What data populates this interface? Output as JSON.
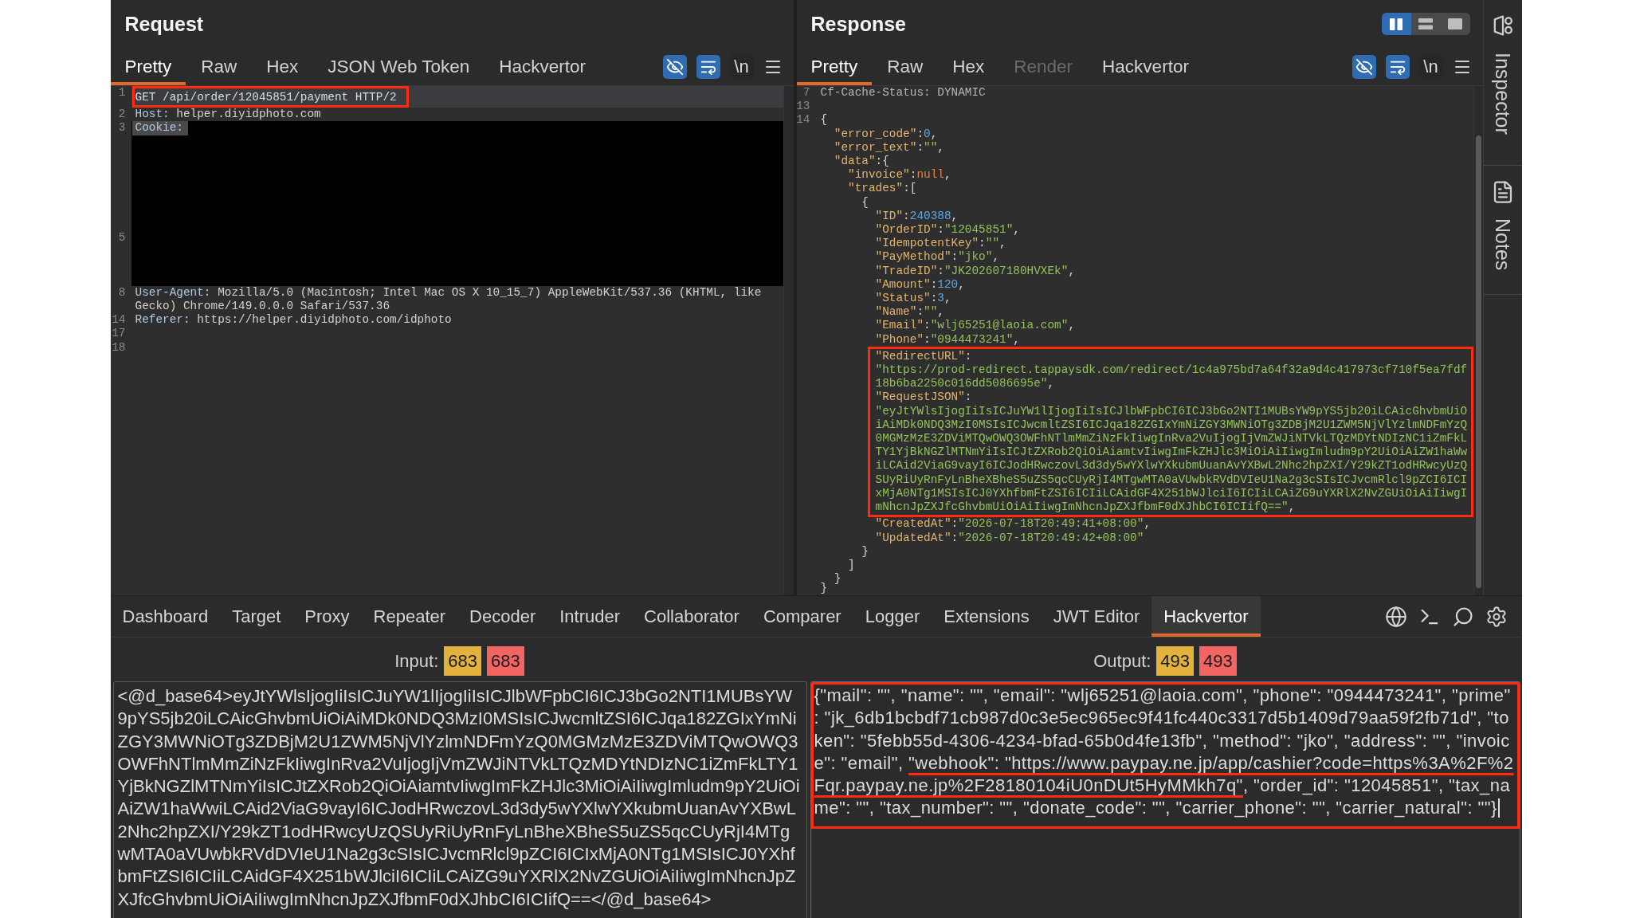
{
  "request": {
    "title": "Request",
    "tabs": [
      {
        "label": "Pretty",
        "selected": true,
        "disabled": false
      },
      {
        "label": "Raw",
        "selected": false,
        "disabled": false
      },
      {
        "label": "Hex",
        "selected": false,
        "disabled": false
      },
      {
        "label": "JSON Web Token",
        "selected": false,
        "disabled": false
      },
      {
        "label": "Hackvertor",
        "selected": false,
        "disabled": false
      }
    ],
    "toggles": [
      {
        "kind": "hide",
        "on": true
      },
      {
        "kind": "wrap",
        "on": true
      },
      {
        "kind": "newline",
        "label": "\\n",
        "on": false
      }
    ],
    "lines": [
      {
        "kind": "code",
        "number": "1",
        "current": true,
        "boxed": true,
        "segments": [
          {
            "kind": "request_line",
            "text": "GET /api/order/12045851/payment HTTP/2"
          }
        ]
      },
      {
        "kind": "code",
        "number": "2",
        "current": false,
        "boxed": false,
        "segments": [
          {
            "kind": "name",
            "text": "Host:"
          },
          {
            "kind": "value",
            "text": "helper.diyidphoto.com"
          }
        ]
      },
      {
        "kind": "redacted",
        "lines": [
          {
            "number": "3",
            "segments": [
              {
                "kind": "name",
                "text": "Cookie:"
              }
            ]
          },
          {
            "number": "5"
          }
        ]
      },
      {
        "kind": "code",
        "number": "8",
        "current": false,
        "boxed": false,
        "segments": [
          {
            "kind": "name",
            "text": "User-Agent:"
          },
          {
            "kind": "value",
            "text": "Mozilla/5.0 (Macintosh; Intel Mac OS X 10_15_7) AppleWebKit/537.36 (KHTML, like Gecko) Chrome/149.0.0.0 Safari/537.36"
          }
        ]
      },
      {
        "kind": "code",
        "number": "14",
        "current": false,
        "boxed": false,
        "segments": [
          {
            "kind": "name",
            "text": "Referer:"
          },
          {
            "kind": "value",
            "text": "https://helper.diyidphoto.com/idphoto"
          }
        ]
      },
      {
        "kind": "code",
        "number": "17",
        "current": false,
        "boxed": false
      },
      {
        "kind": "code",
        "number": "18",
        "current": false,
        "boxed": false
      }
    ]
  },
  "response": {
    "title": "Response",
    "layout_buttons": [
      {
        "kind": "columns",
        "selected": true
      },
      {
        "kind": "rows",
        "selected": false
      },
      {
        "kind": "single",
        "selected": false
      }
    ],
    "tabs": [
      {
        "label": "Pretty",
        "selected": true,
        "disabled": false
      },
      {
        "label": "Raw",
        "selected": false,
        "disabled": false
      },
      {
        "label": "Hex",
        "selected": false,
        "disabled": false
      },
      {
        "label": "Render",
        "selected": false,
        "disabled": true
      },
      {
        "label": "Hackvertor",
        "selected": false,
        "disabled": false
      }
    ],
    "toggles": [
      {
        "kind": "hide",
        "on": true
      },
      {
        "kind": "wrap",
        "on": true
      },
      {
        "kind": "newline",
        "label": "\\n",
        "on": false
      }
    ],
    "lines": [
      {
        "number": "7",
        "segments": [
          {
            "kind": "header",
            "text": "Cf-Cache-Status: DYNAMIC"
          }
        ]
      },
      {
        "number": "13"
      },
      {
        "number": "14",
        "segments": [
          {
            "kind": "punct",
            "text": "{"
          }
        ],
        "children": [
          {
            "segments": [
              {
                "kind": "key",
                "text": "\"error_code\""
              },
              {
                "kind": "punct",
                "text": ":"
              },
              {
                "kind": "number",
                "text": "0"
              },
              {
                "kind": "punct",
                "text": ","
              }
            ]
          },
          {
            "segments": [
              {
                "kind": "key",
                "text": "\"error_text\""
              },
              {
                "kind": "punct",
                "text": ":"
              },
              {
                "kind": "string",
                "text": "\"\""
              },
              {
                "kind": "punct",
                "text": ","
              }
            ]
          },
          {
            "segments": [
              {
                "kind": "key",
                "text": "\"data\""
              },
              {
                "kind": "punct",
                "text": ":{"
              }
            ],
            "children": [
              {
                "segments": [
                  {
                    "kind": "key",
                    "text": "\"invoice\""
                  },
                  {
                    "kind": "punct",
                    "text": ":"
                  },
                  {
                    "kind": "null",
                    "text": "null"
                  },
                  {
                    "kind": "punct",
                    "text": ","
                  }
                ]
              },
              {
                "segments": [
                  {
                    "kind": "key",
                    "text": "\"trades\""
                  },
                  {
                    "kind": "punct",
                    "text": ":["
                  }
                ],
                "children": [
                  {
                    "segments": [
                      {
                        "kind": "punct",
                        "text": "{"
                      }
                    ],
                    "children": [
                      {
                        "kind": "line",
                        "segments": [
                          {
                            "kind": "key",
                            "text": "\"ID\""
                          },
                          {
                            "kind": "punct",
                            "text": ":"
                          },
                          {
                            "kind": "number",
                            "text": "240388"
                          },
                          {
                            "kind": "punct",
                            "text": ","
                          }
                        ]
                      },
                      {
                        "kind": "line",
                        "segments": [
                          {
                            "kind": "key",
                            "text": "\"OrderID\""
                          },
                          {
                            "kind": "punct",
                            "text": ":"
                          },
                          {
                            "kind": "string",
                            "text": "\"12045851\""
                          },
                          {
                            "kind": "punct",
                            "text": ","
                          }
                        ]
                      },
                      {
                        "kind": "line",
                        "segments": [
                          {
                            "kind": "key",
                            "text": "\"IdempotentKey\""
                          },
                          {
                            "kind": "punct",
                            "text": ":"
                          },
                          {
                            "kind": "string",
                            "text": "\"\""
                          },
                          {
                            "kind": "punct",
                            "text": ","
                          }
                        ]
                      },
                      {
                        "kind": "line",
                        "segments": [
                          {
                            "kind": "key",
                            "text": "\"PayMethod\""
                          },
                          {
                            "kind": "punct",
                            "text": ":"
                          },
                          {
                            "kind": "string",
                            "text": "\"jko\""
                          },
                          {
                            "kind": "punct",
                            "text": ","
                          }
                        ]
                      },
                      {
                        "kind": "line",
                        "segments": [
                          {
                            "kind": "key",
                            "text": "\"TradeID\""
                          },
                          {
                            "kind": "punct",
                            "text": ":"
                          },
                          {
                            "kind": "string",
                            "text": "\"JK202607180HVXEk\""
                          },
                          {
                            "kind": "punct",
                            "text": ","
                          }
                        ]
                      },
                      {
                        "kind": "line",
                        "segments": [
                          {
                            "kind": "key",
                            "text": "\"Amount\""
                          },
                          {
                            "kind": "punct",
                            "text": ":"
                          },
                          {
                            "kind": "number",
                            "text": "120"
                          },
                          {
                            "kind": "punct",
                            "text": ","
                          }
                        ]
                      },
                      {
                        "kind": "line",
                        "segments": [
                          {
                            "kind": "key",
                            "text": "\"Status\""
                          },
                          {
                            "kind": "punct",
                            "text": ":"
                          },
                          {
                            "kind": "number",
                            "text": "3"
                          },
                          {
                            "kind": "punct",
                            "text": ","
                          }
                        ]
                      },
                      {
                        "kind": "line",
                        "segments": [
                          {
                            "kind": "key",
                            "text": "\"Name\""
                          },
                          {
                            "kind": "punct",
                            "text": ":"
                          },
                          {
                            "kind": "string",
                            "text": "\"\""
                          },
                          {
                            "kind": "punct",
                            "text": ","
                          }
                        ]
                      },
                      {
                        "kind": "line",
                        "segments": [
                          {
                            "kind": "key",
                            "text": "\"Email\""
                          },
                          {
                            "kind": "punct",
                            "text": ":"
                          },
                          {
                            "kind": "string",
                            "text": "\"wlj65251@laoia.com\""
                          },
                          {
                            "kind": "punct",
                            "text": ","
                          }
                        ]
                      },
                      {
                        "kind": "line",
                        "segments": [
                          {
                            "kind": "key",
                            "text": "\"Phone\""
                          },
                          {
                            "kind": "punct",
                            "text": ":"
                          },
                          {
                            "kind": "string",
                            "text": "\"0944473241\""
                          },
                          {
                            "kind": "punct",
                            "text": ","
                          }
                        ]
                      },
                      {
                        "kind": "annotation_box",
                        "lines": [
                          {
                            "segments": [
                              {
                                "kind": "key",
                                "text": "\"RedirectURL\""
                              },
                              {
                                "kind": "punct",
                                "text": ":"
                              }
                            ]
                          },
                          {
                            "segments": [
                              {
                                "kind": "string",
                                "text": "\"https://prod-redirect.tappaysdk.com/redirect/1c4a975bd7a64f32a9d4c417973cf710f5ea7fdf18b6ba2250c016dd5086695e\""
                              },
                              {
                                "kind": "punct",
                                "text": ","
                              }
                            ]
                          },
                          {
                            "segments": [
                              {
                                "kind": "key",
                                "text": "\"RequestJSON\""
                              },
                              {
                                "kind": "punct",
                                "text": ":"
                              }
                            ]
                          },
                          {
                            "segments": [
                              {
                                "kind": "string",
                                "text": "\"eyJtYWlsIjogIiIsICJuYW1lIjogIiIsICJlbWFpbCI6ICJ3bGo2NTI1MUBsYW9pYS5jb20iLCAicGhvbmUiOiAiMDk0NDQ3MzI0MSIsICJwcmltZSI6ICJqa182ZGIxYmNiZGY3MWNiOTg3ZDBjM2U1ZWM5NjVlYzlmNDFmYzQ0MGMzMzE3ZDViMTQwOWQ3OWFhNTlmMmZiNzFkIiwgInRva2VuIjogIjVmZWJiNTVkLTQzMDYtNDIzNC1iZmFkLTY1YjBkNGZlMTNmYiIsICJtZXRob2QiOiAiamtvIiwgImFkZHJlc3MiOiAiIiwgImludm9pY2UiOiAiZW1haWwiLCAid2ViaG9vayI6ICJodHRwczovL3d3dy5wYXlwYXkubmUuanAvYXBwL2Nhc2hpZXI/Y29kZT1odHRwcyUzQSUyRiUyRnFyLnBheXBheS5uZS5qcCUyRjI4MTgwMTA0aVUwbkRVdDVIeU1Na2g3cSIsICJvcmRlcl9pZCI6ICIxMjA0NTg1MSIsICJ0YXhfbmFtZSI6ICIiLCAidGF4X251bWJlciI6ICIiLCAiZG9uYXRlX2NvZGUiOiAiIiwgImNhcnJpZXJfcGhvbmUiOiAiIiwgImNhcnJpZXJfbmF0dXJhbCI6ICIifQ==\""
                              },
                              {
                                "kind": "punct",
                                "text": ","
                              }
                            ]
                          }
                        ]
                      },
                      {
                        "kind": "line",
                        "segments": [
                          {
                            "kind": "key",
                            "text": "\"CreatedAt\""
                          },
                          {
                            "kind": "punct",
                            "text": ":"
                          },
                          {
                            "kind": "string",
                            "text": "\"2026-07-18T20:49:41+08:00\""
                          },
                          {
                            "kind": "punct",
                            "text": ","
                          }
                        ]
                      },
                      {
                        "kind": "line",
                        "segments": [
                          {
                            "kind": "key",
                            "text": "\"UpdatedAt\""
                          },
                          {
                            "kind": "punct",
                            "text": ":"
                          },
                          {
                            "kind": "string",
                            "text": "\"2026-07-18T20:49:42+08:00\""
                          }
                        ]
                      }
                    ]
                  },
                  {
                    "segments": [
                      {
                        "kind": "punct",
                        "text": "}"
                      }
                    ]
                  }
                ]
              },
              {
                "segments": [
                  {
                    "kind": "punct",
                    "text": "]"
                  }
                ]
              }
            ]
          },
          {
            "segments": [
              {
                "kind": "punct",
                "text": "}"
              }
            ]
          }
        ]
      },
      {
        "segments": [
          {
            "kind": "punct",
            "text": "}"
          }
        ]
      }
    ]
  },
  "sidebar": {
    "items": [
      {
        "kind": "inspector",
        "label": "Inspector"
      },
      {
        "kind": "notes",
        "label": "Notes"
      }
    ]
  },
  "tool_tabs": [
    {
      "label": "Dashboard",
      "selected": false
    },
    {
      "label": "Target",
      "selected": false
    },
    {
      "label": "Proxy",
      "selected": false
    },
    {
      "label": "Repeater",
      "selected": false
    },
    {
      "label": "Decoder",
      "selected": false
    },
    {
      "label": "Intruder",
      "selected": false
    },
    {
      "label": "Collaborator",
      "selected": false
    },
    {
      "label": "Comparer",
      "selected": false
    },
    {
      "label": "Logger",
      "selected": false
    },
    {
      "label": "Extensions",
      "selected": false
    },
    {
      "label": "JWT Editor",
      "selected": false
    },
    {
      "label": "Hackvertor",
      "selected": true
    }
  ],
  "hackvertor": {
    "input": {
      "label": "Input:",
      "counts": [
        {
          "text": "683",
          "color": "#e3b23c"
        },
        {
          "text": "683",
          "color": "#f36563"
        }
      ],
      "focused": false,
      "value": "<@d_base64>eyJtYWlsIjogIiIsICJuYW1lIjogIiIsICJlbWFpbCI6ICJ3bGo2NTI1MUBsYW9pYS5jb20iLCAicGhvbmUiOiAiMDk0NDQ3MzI0MSIsICJwcmltZSI6ICJqa182ZGIxYmNiZGY3MWNiOTg3ZDBjM2U1ZWM5NjVlYzlmNDFmYzQ0MGMzMzE3ZDViMTQwOWQ3OWFhNTlmMmZiNzFkIiwgInRva2VuIjogIjVmZWJiNTVkLTQzMDYtNDIzNC1iZmFkLTY1YjBkNGZlMTNmYiIsICJtZXRob2QiOiAiamtvIiwgImFkZHJlc3MiOiAiIiwgImludm9pY2UiOiAiZW1haWwiLCAid2ViaG9vayI6ICJodHRwczovL3d3dy5wYXlwYXkubmUuanAvYXBwL2Nhc2hpZXI/Y29kZT1odHRwcyUzQSUyRiUyRnFyLnBheXBheS5uZS5qcCUyRjI4MTgwMTA0aVUwbkRVdDVIeU1Na2g3cSIsICJvcmRlcl9pZCI6ICIxMjA0NTg1MSIsICJ0YXhfbmFtZSI6ICIiLCAidGF4X251bWJlciI6ICIiLCAiZG9uYXRlX2NvZGUiOiAiIiwgImNhcnJpZXJfcGhvbmUiOiAiIiwgImNhcnJpZXJfbmF0dXJhbCI6ICIifQ==</@d_base64>"
    },
    "output": {
      "label": "Output:",
      "counts": [
        {
          "text": "493",
          "color": "#e3b23c"
        },
        {
          "text": "493",
          "color": "#f36563"
        }
      ],
      "focused": true,
      "boxed": true,
      "segments": [
        {
          "text": "{\"mail\": \"\", \"name\": \"\", \"email\": \"wlj65251@laoia.com\", \"phone\": \"0944473241\", \"prime\": \"jk_6db1bcbdf71cb987d0c3e5ec965ec9f41fc440c3317d5b1409d79aa59f2fb71d\", \"token\": \"5febb55d-4306-4234-bfad-65b0d4fe13fb\", \"method\": \"jko\", \"address\": \"\", \"invoice\": \"email\", ",
          "underlined": false
        },
        {
          "text": "\"webhook\": \"https://www.paypay.ne.jp/app/cashier?code=https%3A%2F%2Fqr.paypay.ne.jp%2F28180104iU0nDUt5HyMMkh7q\"",
          "underlined": true
        },
        {
          "text": ", \"order_id\": \"12045851\", \"tax_name\": \"\", \"tax_number\": \"\", \"donate_code\": \"\", \"carrier_phone\": \"\", \"carrier_natural\": \"\"}",
          "underlined": false
        }
      ]
    }
  }
}
